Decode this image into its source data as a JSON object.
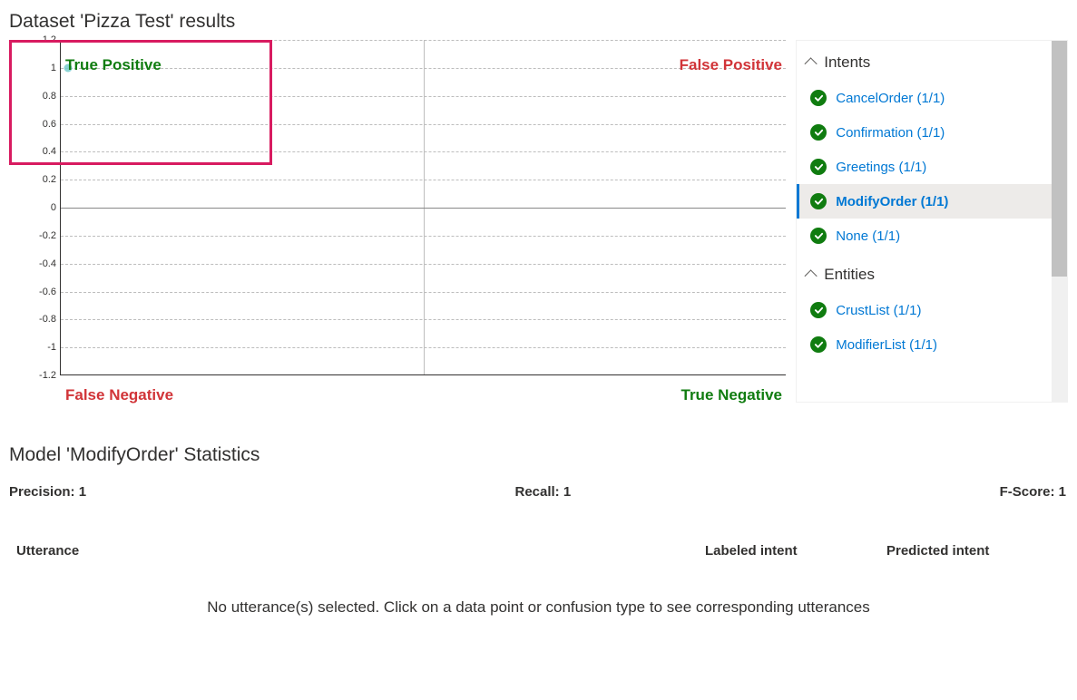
{
  "page_title": "Dataset 'Pizza Test' results",
  "chart_data": {
    "type": "scatter",
    "title": "",
    "xlabel": "",
    "ylabel": "",
    "ylim": [
      -1.2,
      1.2
    ],
    "yticks": [
      1.2,
      1,
      0.8,
      0.6,
      0.4,
      0.2,
      0,
      -0.2,
      -0.4,
      -0.6,
      -0.8,
      -1,
      -1.2
    ],
    "quadrants": {
      "top_left": "True Positive",
      "top_right": "False Positive",
      "bottom_left": "False Negative",
      "bottom_right": "True Negative"
    },
    "series": [
      {
        "name": "ModifyOrder",
        "x": [
          0.01
        ],
        "y": [
          1.0
        ]
      }
    ]
  },
  "sidebar": {
    "sections": [
      {
        "title": "Intents",
        "items": [
          {
            "label": "CancelOrder (1/1)",
            "status": "ok",
            "selected": false
          },
          {
            "label": "Confirmation (1/1)",
            "status": "ok",
            "selected": false
          },
          {
            "label": "Greetings (1/1)",
            "status": "ok",
            "selected": false
          },
          {
            "label": "ModifyOrder (1/1)",
            "status": "ok",
            "selected": true
          },
          {
            "label": "None (1/1)",
            "status": "ok",
            "selected": false
          }
        ]
      },
      {
        "title": "Entities",
        "items": [
          {
            "label": "CrustList (1/1)",
            "status": "ok",
            "selected": false
          },
          {
            "label": "ModifierList (1/1)",
            "status": "ok",
            "selected": false
          }
        ]
      }
    ]
  },
  "stats": {
    "title": "Model 'ModifyOrder' Statistics",
    "precision_label": "Precision: 1",
    "recall_label": "Recall: 1",
    "fscore_label": "F-Score: 1"
  },
  "table": {
    "headers": {
      "utterance": "Utterance",
      "labeled": "Labeled intent",
      "predicted": "Predicted intent"
    },
    "empty_message": "No utterance(s) selected. Click on a data point or confusion type to see corresponding utterances"
  }
}
